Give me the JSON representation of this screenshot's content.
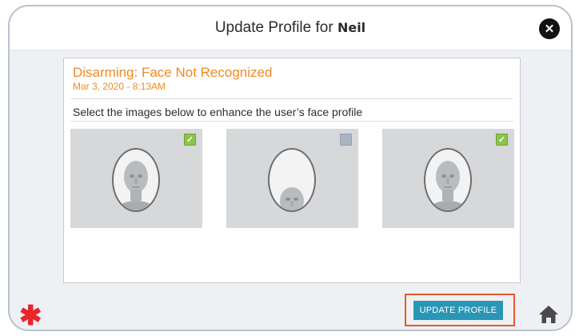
{
  "header": {
    "title_prefix": "Update Profile for",
    "user_name": "Neil",
    "close_icon": "close-icon"
  },
  "alert": {
    "title": "Disarming: Face Not Recognized",
    "timestamp": "Mar 3, 2020 - 8:13AM",
    "instruction": "Select the images below to enhance the user’s face profile"
  },
  "images": [
    {
      "selected": true,
      "checkbox_icon": "checkmark-icon"
    },
    {
      "selected": false,
      "checkbox_icon": "checkbox-empty-icon"
    },
    {
      "selected": true,
      "checkbox_icon": "checkmark-icon"
    }
  ],
  "footer": {
    "update_button_label": "UPDATE PROFILE",
    "asterisk_icon": "asterisk-icon",
    "home_icon": "home-icon"
  },
  "colors": {
    "accent_orange": "#f08a24",
    "button_teal": "#2a96b6",
    "highlight_border": "#e8572c",
    "check_green": "#8cc34b",
    "asterisk_red": "#e8262a"
  }
}
